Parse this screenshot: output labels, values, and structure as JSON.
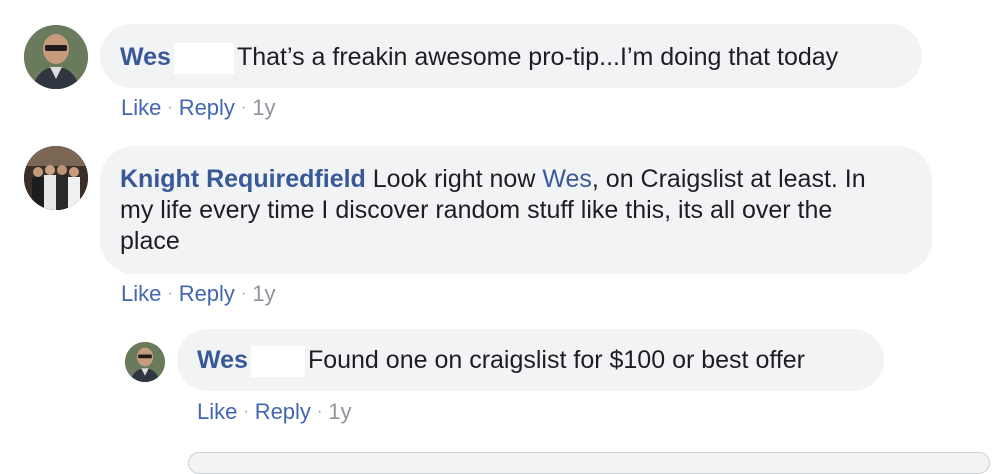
{
  "comments": [
    {
      "author": "Wes",
      "text": "That’s a freakin awesome pro-tip...I’m doing that today",
      "actions": {
        "like": "Like",
        "reply": "Reply",
        "time": "1y"
      }
    },
    {
      "author": "Knight Requiredfield",
      "text_before": "Look right now",
      "mention": "Wes",
      "text_line1_after": ", on Craigslist at least. In",
      "text_line2": "my life every time I discover random stuff like this, its all over the",
      "text_line3": "place",
      "actions": {
        "like": "Like",
        "reply": "Reply",
        "time": "1y"
      }
    },
    {
      "author": "Wes",
      "text": "Found one on craigslist for $100 or best offer",
      "actions": {
        "like": "Like",
        "reply": "Reply",
        "time": "1y"
      }
    }
  ],
  "separator": "·"
}
